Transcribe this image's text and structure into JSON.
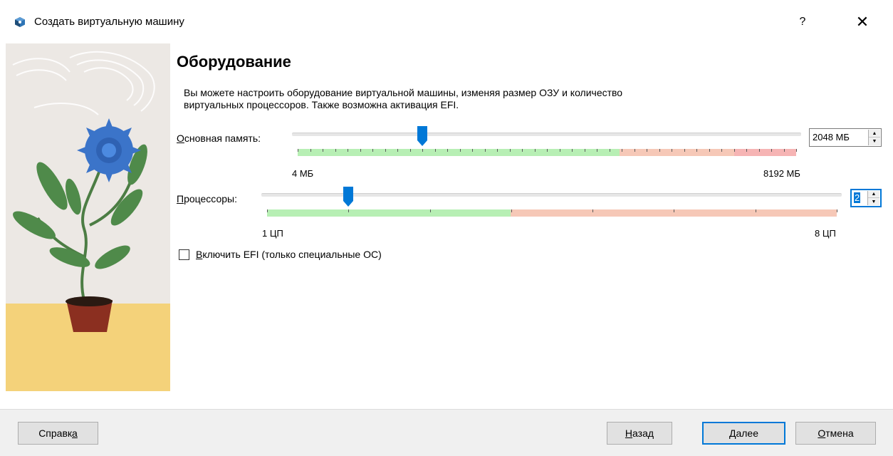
{
  "window": {
    "title": "Создать виртуальную машину",
    "help_symbol": "?",
    "close_symbol": "✕",
    "app_icon": "virtualbox-icon"
  },
  "page": {
    "heading": "Оборудование",
    "description_line1": "Вы можете настроить оборудование виртуальной машины, изменяя размер ОЗУ и количество",
    "description_line2": "виртуальных процессоров. Также возможна активация EFI."
  },
  "memory": {
    "label_mnemonic": "О",
    "label_rest": "сновная память:",
    "min_label": "4 МБ",
    "max_label": "8192 МБ",
    "value_display": "2048 МБ",
    "value": 2048,
    "min": 4,
    "max": 8192
  },
  "cpu": {
    "label_mnemonic": "П",
    "label_rest": "роцессоры:",
    "min_label": "1 ЦП",
    "max_label": "8 ЦП",
    "value_display": "2",
    "value": 2,
    "min": 1,
    "max": 8
  },
  "efi": {
    "label_mnemonic": "В",
    "label_rest": "ключить EFI (только специальные ОС)",
    "checked": false
  },
  "buttons": {
    "help_pre": "Справк",
    "help_mn": "а",
    "back_mn": "Н",
    "back_rest": "азад",
    "next_mn": "Д",
    "next_rest": "алее",
    "cancel_mn": "О",
    "cancel_rest": "тмена"
  },
  "colors": {
    "scale_green": "#b7efb4",
    "scale_orange": "#f6c8b7",
    "scale_red": "#f6b4b4",
    "handle_blue": "#0078d7",
    "focus_blue": "#0078d7"
  }
}
